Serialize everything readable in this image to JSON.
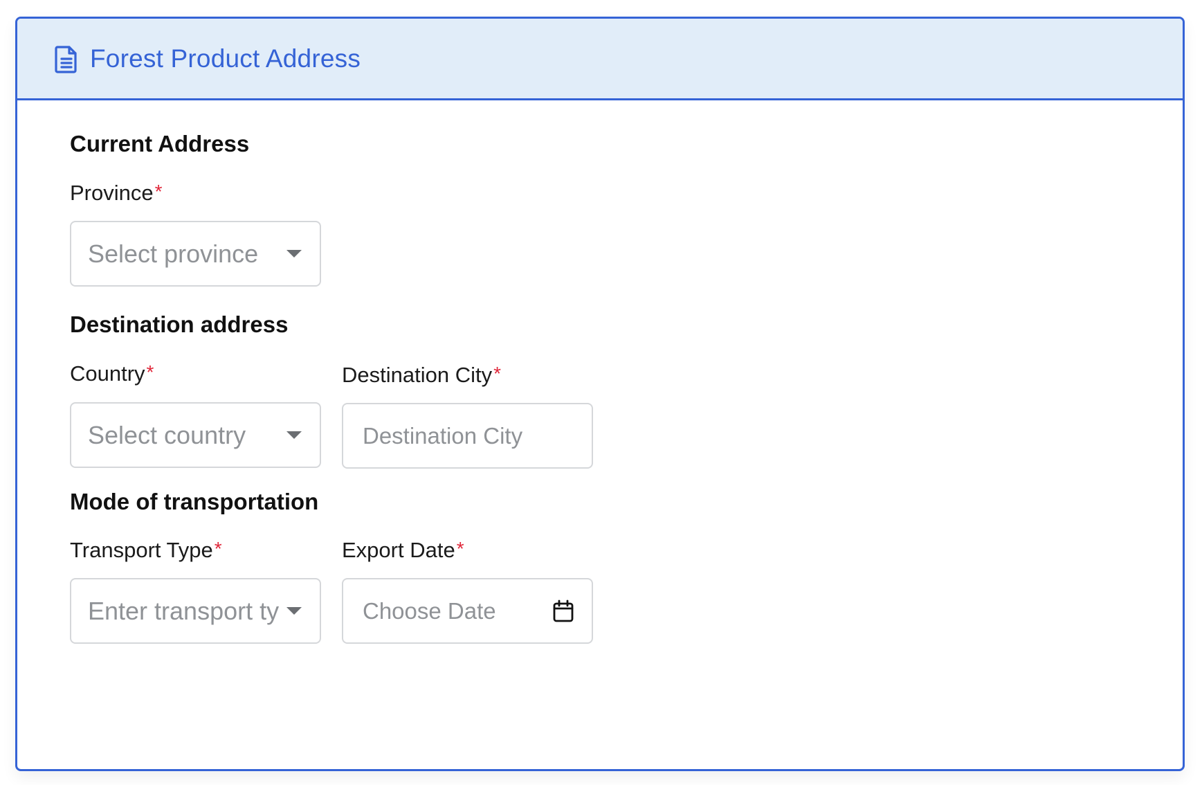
{
  "header": {
    "icon": "document-icon",
    "title": "Forest Product Address",
    "accent_color": "#3563d6",
    "background_color": "#e1edf9"
  },
  "current_address": {
    "heading": "Current Address",
    "province": {
      "label": "Province",
      "required_mark": "*",
      "placeholder": "Select province"
    }
  },
  "destination_address": {
    "heading": "Destination address",
    "country": {
      "label": "Country",
      "required_mark": "*",
      "placeholder": "Select country"
    },
    "destination_city": {
      "label": "Destination City",
      "required_mark": "*",
      "placeholder": "Destination City"
    }
  },
  "transportation": {
    "heading": "Mode of transportation",
    "transport_type": {
      "label": "Transport Type",
      "required_mark": "*",
      "placeholder": "Enter transport type"
    },
    "export_date": {
      "label": "Export Date",
      "required_mark": "*",
      "placeholder": "Choose Date",
      "icon": "calendar-icon"
    }
  },
  "required_color": "#e0273a"
}
